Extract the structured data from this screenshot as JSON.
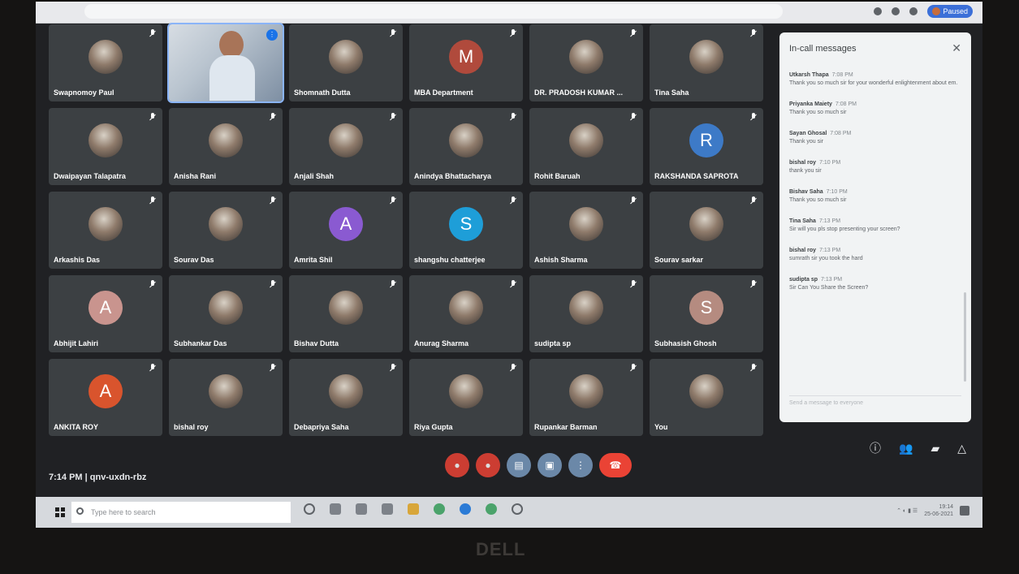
{
  "browser": {
    "profile_label": "Paused"
  },
  "participants": [
    {
      "name": "Swapnomoy Paul",
      "type": "photo"
    },
    {
      "name": "",
      "type": "video"
    },
    {
      "name": "Shomnath Dutta",
      "type": "photo"
    },
    {
      "name": "MBA Department",
      "type": "letter",
      "letter": "M",
      "color": "#b04a3c"
    },
    {
      "name": "DR. PRADOSH KUMAR ...",
      "type": "photo"
    },
    {
      "name": "Tina Saha",
      "type": "photo"
    },
    {
      "name": "Dwaipayan Talapatra",
      "type": "photo"
    },
    {
      "name": "Anisha Rani",
      "type": "photo"
    },
    {
      "name": "Anjali Shah",
      "type": "photo"
    },
    {
      "name": "Anindya Bhattacharya",
      "type": "photo"
    },
    {
      "name": "Rohit Baruah",
      "type": "photo"
    },
    {
      "name": "RAKSHANDA SAPROTA",
      "type": "letter",
      "letter": "R",
      "color": "#3d7ac7"
    },
    {
      "name": "Arkashis Das",
      "type": "photo"
    },
    {
      "name": "Sourav Das",
      "type": "photo"
    },
    {
      "name": "Amrita Shil",
      "type": "letter",
      "letter": "A",
      "color": "#8a5ad1"
    },
    {
      "name": "shangshu chatterjee",
      "type": "letter",
      "letter": "S",
      "color": "#1e9ed8"
    },
    {
      "name": "Ashish Sharma",
      "type": "photo"
    },
    {
      "name": "Sourav sarkar",
      "type": "photo"
    },
    {
      "name": "Abhijit Lahiri",
      "type": "letter",
      "letter": "A",
      "color": "#c9948e"
    },
    {
      "name": "Subhankar Das",
      "type": "photo"
    },
    {
      "name": "Bishav Dutta",
      "type": "photo"
    },
    {
      "name": "Anurag Sharma",
      "type": "photo"
    },
    {
      "name": "sudipta sp",
      "type": "photo"
    },
    {
      "name": "Subhasish Ghosh",
      "type": "letter",
      "letter": "S",
      "color": "#b58b80"
    },
    {
      "name": "ANKITA ROY",
      "type": "letter",
      "letter": "A",
      "color": "#d9542d"
    },
    {
      "name": "bishal roy",
      "type": "photo"
    },
    {
      "name": "Debapriya Saha",
      "type": "photo"
    },
    {
      "name": "Riya Gupta",
      "type": "photo"
    },
    {
      "name": "Rupankar Barman",
      "type": "photo"
    },
    {
      "name": "You",
      "type": "photo"
    }
  ],
  "chat": {
    "title": "In-call messages",
    "close_icon": "close-icon",
    "messages": [
      {
        "sender": "Utkarsh Thapa",
        "time": "7:08 PM",
        "text": "Thank you so much sir for your wonderful enlightenment about em."
      },
      {
        "sender": "Priyanka Maiety",
        "time": "7:08 PM",
        "text": "Thank you so much sir"
      },
      {
        "sender": "Sayan Ghosal",
        "time": "7:08 PM",
        "text": "Thank you sir"
      },
      {
        "sender": "bishal roy",
        "time": "7:10 PM",
        "text": "thank you sir"
      },
      {
        "sender": "Bishav Saha",
        "time": "7:10 PM",
        "text": "Thank you so much sir"
      },
      {
        "sender": "Tina Saha",
        "time": "7:13 PM",
        "text": "Sir will you pls stop presenting your screen?"
      },
      {
        "sender": "bishal roy",
        "time": "7:13 PM",
        "text": "sumrath sir you took the hard"
      },
      {
        "sender": "sudipta sp",
        "time": "7:13 PM",
        "text": "Sir Can You Share the Screen?"
      }
    ],
    "input_placeholder": "Send a message to everyone"
  },
  "controls": {
    "time_code": "7:14 PM  |  qnv-uxdn-rbz"
  },
  "taskbar": {
    "search_placeholder": "Type here to search",
    "clock_time": "19:14",
    "clock_date": "25-06-2021"
  },
  "hardware": {
    "brand": "DELL"
  }
}
